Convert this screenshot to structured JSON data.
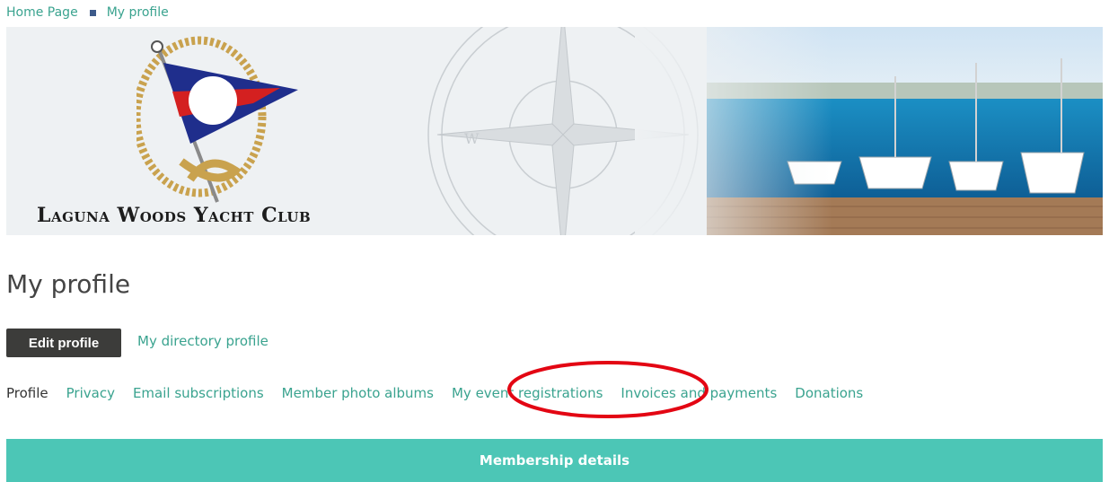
{
  "breadcrumb": {
    "home": "Home Page",
    "current": "My profile"
  },
  "banner": {
    "club_name": "Laguna Woods Yacht Club"
  },
  "page": {
    "title": "My profile"
  },
  "actions": {
    "edit_profile": "Edit profile",
    "directory_profile": "My directory profile"
  },
  "tabs": [
    {
      "label": "Profile"
    },
    {
      "label": "Privacy"
    },
    {
      "label": "Email subscriptions"
    },
    {
      "label": "Member photo albums"
    },
    {
      "label": "My event registrations"
    },
    {
      "label": "Invoices and payments"
    },
    {
      "label": "Donations"
    }
  ],
  "section": {
    "membership_details": "Membership details"
  },
  "colors": {
    "accent": "#3aa38f",
    "bar": "#4cc6b6",
    "annotation": "#e30613",
    "button": "#3c3c3a"
  }
}
